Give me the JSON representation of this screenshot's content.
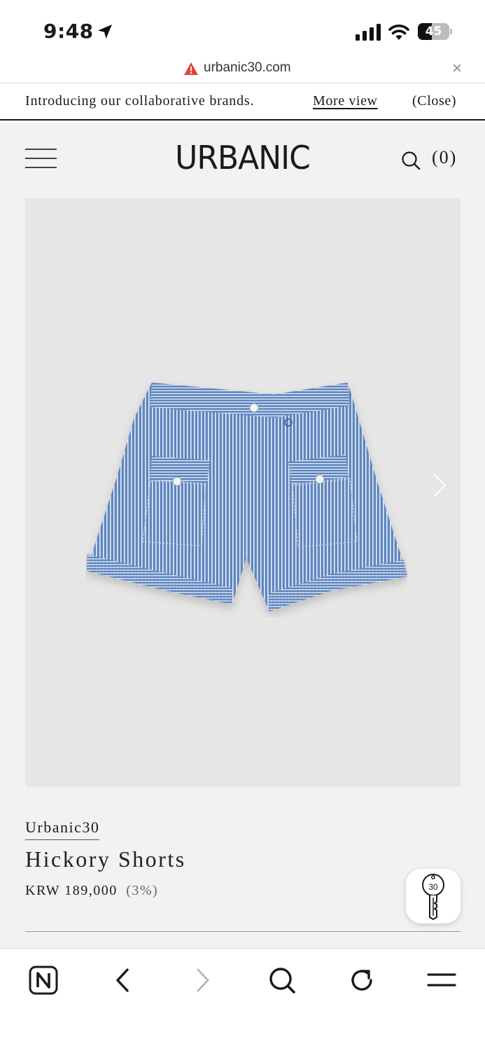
{
  "status_bar": {
    "time": "9:48",
    "battery_level": "45",
    "battery_fraction": 0.45
  },
  "url_bar": {
    "url": "urbanic30.com",
    "close_glyph": "×"
  },
  "announcement": {
    "text": "Introducing our collaborative brands.",
    "more_label": "More view",
    "close_label": "(Close)"
  },
  "header": {
    "logo": "URBANIC",
    "cart_count": "(0)"
  },
  "product": {
    "brand": "Urbanic30",
    "title": "Hickory Shorts",
    "price": "KRW 189,000",
    "discount": "(3%)"
  },
  "key_button": {
    "label": "30"
  },
  "icons": {
    "location": "location-arrow-icon",
    "signal": "cellular-signal-icon",
    "wifi": "wifi-icon",
    "warning": "warning-icon",
    "menu": "hamburger-menu-icon",
    "search": "search-icon",
    "next": "chevron-right-icon",
    "key": "key-icon",
    "naver": "naver-n-icon",
    "back": "chevron-left-icon",
    "forward": "chevron-right-icon",
    "refresh": "refresh-icon",
    "more": "menu-icon"
  },
  "colors": {
    "page_background": "#f2f2f2",
    "image_background": "#e6e6e6",
    "warning": "#e0453a",
    "denim": "#5f86bf"
  }
}
